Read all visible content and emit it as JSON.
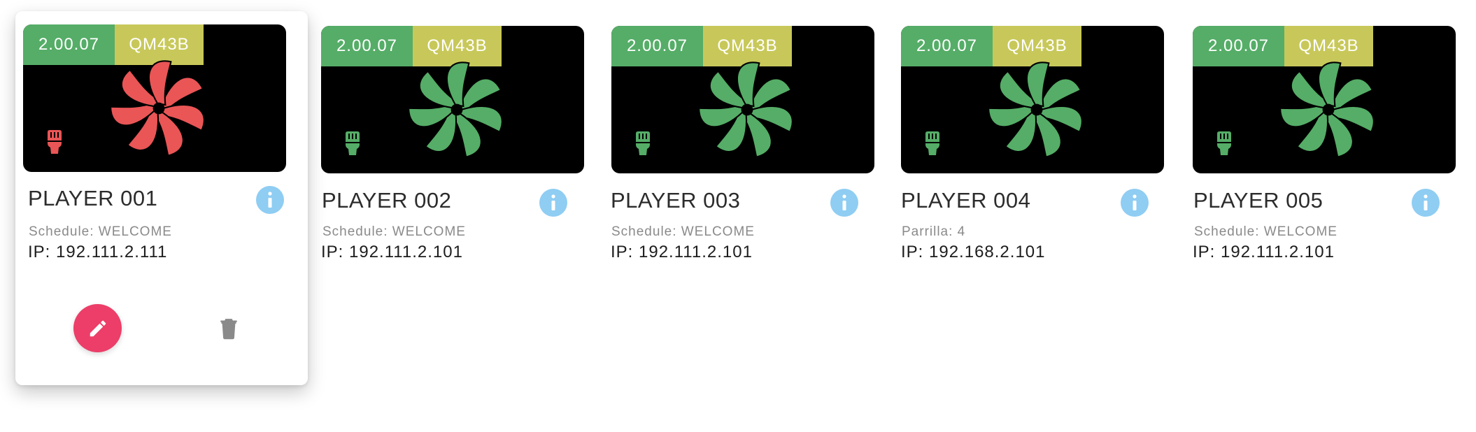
{
  "colors": {
    "online": "#55ad67",
    "offline": "#ea5556",
    "version_badge": "#55ad67",
    "model_badge": "#c8c85a",
    "info": "#8fcdf3",
    "edit": "#ec3e68",
    "delete": "#8a8a8a"
  },
  "players": [
    {
      "name": "PLAYER 001",
      "version": "2.00.07",
      "model": "QM43B",
      "subtitle": "Schedule: WELCOME",
      "ip": "IP: 192.111.2.111",
      "status": "offline"
    },
    {
      "name": "PLAYER 002",
      "version": "2.00.07",
      "model": "QM43B",
      "subtitle": "Schedule: WELCOME",
      "ip": "IP: 192.111.2.101",
      "status": "online"
    },
    {
      "name": "PLAYER 003",
      "version": "2.00.07",
      "model": "QM43B",
      "subtitle": "Schedule: WELCOME",
      "ip": "IP: 192.111.2.101",
      "status": "online"
    },
    {
      "name": "PLAYER 004",
      "version": "2.00.07",
      "model": "QM43B",
      "subtitle": "Parrilla: 4",
      "ip": "IP: 192.168.2.101",
      "status": "online"
    },
    {
      "name": "PLAYER 005",
      "version": "2.00.07",
      "model": "QM43B",
      "subtitle": "Schedule: WELCOME",
      "ip": "IP: 192.111.2.101",
      "status": "online"
    }
  ],
  "icons": {
    "fan": "fan-icon",
    "plug": "plug-icon",
    "info": "info-icon",
    "edit": "pencil-icon",
    "delete": "trash-icon"
  }
}
